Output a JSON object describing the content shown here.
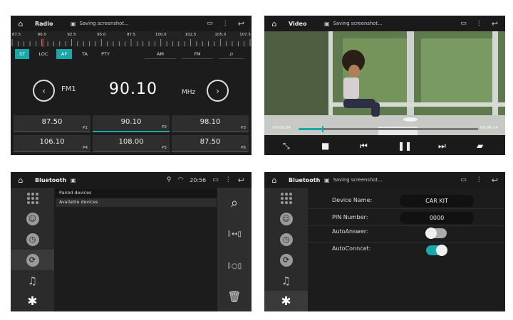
{
  "radio": {
    "title": "Radio",
    "status": "Saving screenshot...",
    "tuner_labels": [
      "87.5",
      "90.0",
      "92.5",
      "95.0",
      "97.5",
      "100.0",
      "102.5",
      "105.0",
      "107.5"
    ],
    "tuner_position_mhz": 90.1,
    "tabs": [
      "ST",
      "LOC",
      "AF",
      "TA",
      "PTY",
      "AM",
      "FM"
    ],
    "active_tabs": [
      "ST",
      "AF"
    ],
    "band": "FM1",
    "frequency": "90.10",
    "unit": "MHz",
    "presets": [
      {
        "value": "87.50",
        "label": "P1"
      },
      {
        "value": "90.10",
        "label": "P2"
      },
      {
        "value": "98.10",
        "label": "P3"
      },
      {
        "value": "106.10",
        "label": "P4"
      },
      {
        "value": "108.00",
        "label": "P5"
      },
      {
        "value": "87.50",
        "label": "P6"
      }
    ],
    "selected_preset": "P2",
    "accent": "#1aa7a7"
  },
  "video": {
    "title": "Video",
    "status": "Saving screenshot...",
    "elapsed": "00:00:34",
    "total": "00:04:14",
    "progress_fraction": 0.134
  },
  "bt1": {
    "title": "Bluetooth",
    "time": "20:56",
    "items": [
      "Paired devices",
      "Available devices"
    ],
    "icons": [
      "apps-grid-icon",
      "contacts-icon",
      "history-icon",
      "bluetooth-sync-icon",
      "music-icon",
      "settings-icon"
    ]
  },
  "bt2": {
    "title": "Bluetooth",
    "status": "Saving screenshot...",
    "device_name_label": "Device Name:",
    "device_name": "CAR KIT",
    "pin_label": "PIN Number:",
    "pin": "0000",
    "auto_answer_label": "AutoAnswer:",
    "auto_answer": false,
    "auto_connect_label": "AutoConncet:",
    "auto_connect": true
  }
}
